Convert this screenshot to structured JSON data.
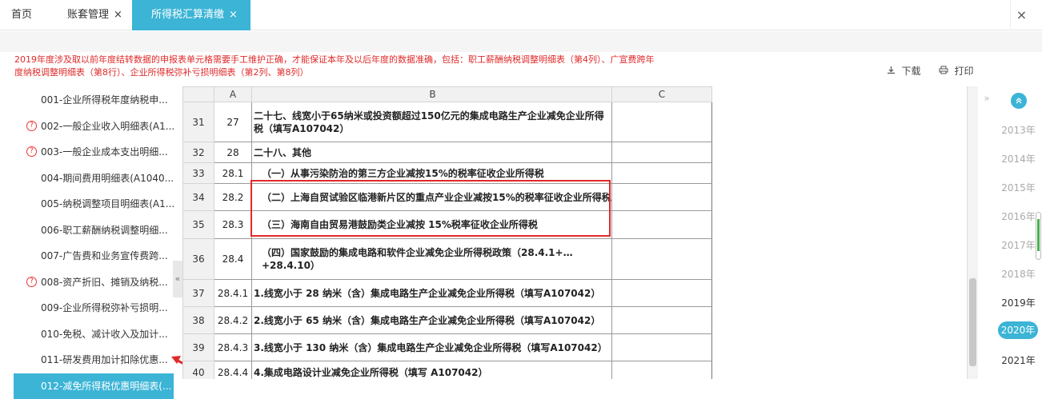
{
  "tabs": {
    "home": "首页",
    "accounts": "账套管理",
    "active": "所得税汇算清缴",
    "close_glyph": "×"
  },
  "window_close": "×",
  "notice": "2019年度涉及取以前年度结转数据的申报表单元格需要手工维护正确，才能保证本年及以后年度的数据准确，包括：职工薪酬纳税调整明细表（第4列）、广宣费跨年度纳税调整明细表（第8行）、企业所得税弥补亏损明细表（第2列、第8列）",
  "toolbar": {
    "download": "下载",
    "print": "打印"
  },
  "sidebar": [
    {
      "label": "001-企业所得税年度纳税申...",
      "warn": false
    },
    {
      "label": "002-一般企业收入明细表(A1...",
      "warn": true
    },
    {
      "label": "003-一般企业成本支出明细...",
      "warn": true
    },
    {
      "label": "004-期间费用明细表(A1040...",
      "warn": false
    },
    {
      "label": "005-纳税调整项目明细表(A1...",
      "warn": false
    },
    {
      "label": "006-职工薪酬纳税调整明细...",
      "warn": false
    },
    {
      "label": "007-广告费和业务宣传费跨...",
      "warn": false
    },
    {
      "label": "008-资产折旧、摊销及纳税...",
      "warn": true
    },
    {
      "label": "009-企业所得税弥补亏损明...",
      "warn": false
    },
    {
      "label": "010-免税、减计收入及加计...",
      "warn": false
    },
    {
      "label": "011-研发费用加计扣除优惠...",
      "warn": false
    },
    {
      "label": "012-减免所得税优惠明细表(...",
      "warn": false,
      "selected": true
    }
  ],
  "sheet": {
    "columns": [
      "A",
      "B",
      "C"
    ],
    "rows": [
      {
        "rn": "31",
        "a": "27",
        "b": "二十七、线宽小于65纳米或投资额超过150亿元的集成电路生产企业减免企业所得税（填写A107042）",
        "c": ""
      },
      {
        "rn": "32",
        "a": "28",
        "b": "二十八、其他",
        "c": ""
      },
      {
        "rn": "33",
        "a": "28.1",
        "b": "（一）从事污染防治的第三方企业减按15%的税率征收企业所得税",
        "c": ""
      },
      {
        "rn": "34",
        "a": "28.2",
        "b": "（二）上海自贸试验区临港新片区的重点产业企业减按15%的税率征收企业所得税",
        "c": ""
      },
      {
        "rn": "35",
        "a": "28.3",
        "b": "（三）海南自由贸易港鼓励类企业减按 15%税率征收企业所得税",
        "c": ""
      },
      {
        "rn": "36",
        "a": "28.4",
        "b": "（四）国家鼓励的集成电路和软件企业减免企业所得税政策（28.4.1+…+28.4.10）",
        "c": ""
      },
      {
        "rn": "37",
        "a": "28.4.1",
        "b": "1.线宽小于 28 纳米（含）集成电路生产企业减免企业所得税（填写A107042）",
        "c": ""
      },
      {
        "rn": "38",
        "a": "28.4.2",
        "b": "2.线宽小于 65 纳米（含）集成电路生产企业减免企业所得税（填写A107042）",
        "c": ""
      },
      {
        "rn": "39",
        "a": "28.4.3",
        "b": "3.线宽小于 130 纳米（含）集成电路生产企业减免企业所得税（填写A107042）",
        "c": ""
      },
      {
        "rn": "40",
        "a": "28.4.4",
        "b": "4.集成电路设计业减免企业所得税（填写 A107042）",
        "c": ""
      }
    ]
  },
  "years": {
    "list": [
      "2013年",
      "2014年",
      "2015年",
      "2016年",
      "2017年",
      "2018年",
      "2019年",
      "2020年",
      "2021年"
    ],
    "active": "2020年"
  },
  "colors": {
    "accent": "#3bb4d6",
    "warning": "#e02a2a"
  }
}
